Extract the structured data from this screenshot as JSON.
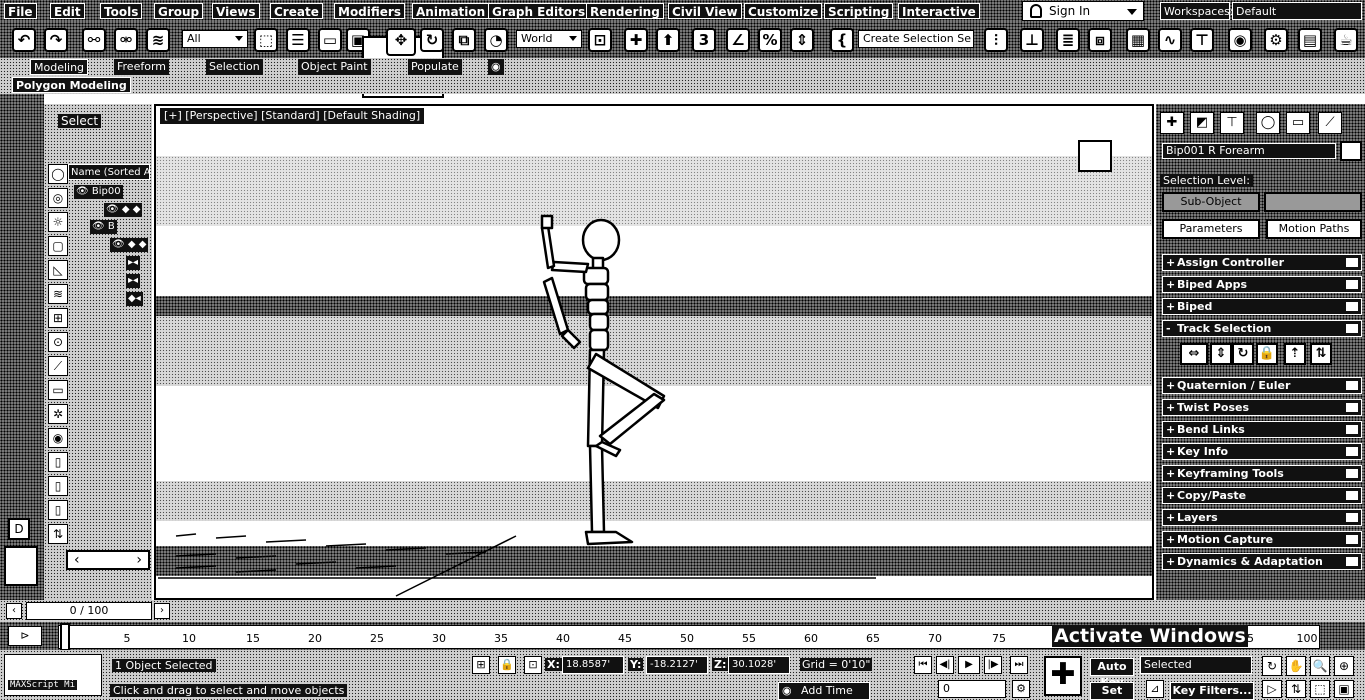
{
  "menu": [
    "File",
    "Edit",
    "Tools",
    "Group",
    "Views",
    "Create",
    "Modifiers",
    "Animation",
    "Graph Editors",
    "Rendering",
    "Civil View",
    "Customize",
    "Scripting",
    "Interactive"
  ],
  "signin_label": "Sign In",
  "workspaces_label": "Workspaces:",
  "workspace_value": "Default",
  "toolbar": {
    "selection_filter": "All",
    "ref_coord": "World",
    "named_selection": "Create Selection Se"
  },
  "ribbon_tabs": [
    "Modeling",
    "Freeform",
    "Selection",
    "Object Paint",
    "Populate"
  ],
  "ribbon_subtitle": "Polygon Modeling",
  "scene_explorer": {
    "select_label": "Select",
    "name_column": "Name (Sorted A",
    "tree_items": [
      "Bip00",
      "◆ ◆",
      "B",
      "◆ ◆"
    ]
  },
  "viewport": {
    "labels": "[+] [Perspective] [Standard] [Default Shading]"
  },
  "command_panel": {
    "object_name": "Bip001 R Forearm",
    "selection_level_label": "Selection Level:",
    "sub_object": "Sub-Object",
    "parameters_button": "Parameters",
    "motion_paths_button": "Motion Paths",
    "rollouts_top": [
      {
        "sign": "+",
        "label": "Assign Controller"
      },
      {
        "sign": "+",
        "label": "Biped Apps"
      },
      {
        "sign": "+",
        "label": "Biped"
      },
      {
        "sign": "-",
        "label": "Track Selection"
      }
    ],
    "rollouts_bottom": [
      {
        "sign": "+",
        "label": "Quaternion / Euler"
      },
      {
        "sign": "+",
        "label": "Twist Poses"
      },
      {
        "sign": "+",
        "label": "Bend Links"
      },
      {
        "sign": "+",
        "label": "Key Info"
      },
      {
        "sign": "+",
        "label": "Keyframing Tools"
      },
      {
        "sign": "+",
        "label": "Copy/Paste"
      },
      {
        "sign": "+",
        "label": "Layers"
      },
      {
        "sign": "+",
        "label": "Motion Capture"
      },
      {
        "sign": "+",
        "label": "Dynamics & Adaptation"
      }
    ]
  },
  "time_slider": {
    "frame_counter": "0 / 100",
    "ticks": [
      "5",
      "10",
      "15",
      "20",
      "25",
      "30",
      "35",
      "40",
      "45",
      "50",
      "55",
      "60",
      "65",
      "70",
      "75",
      "95",
      "100"
    ]
  },
  "watermark": "Activate Windows",
  "status": {
    "maxscript": "MAXScript Mi",
    "selected": "1 Object Selected",
    "prompt": "Click and drag to select and move objects",
    "x_label": "X:",
    "y_label": "Y:",
    "z_label": "Z:",
    "x": "18.8587'",
    "y": "-18.2127'",
    "z": "30.1028'",
    "grid": "Grid = 0'10\"",
    "add_time_tag": "Add Time Tag",
    "current_frame": "0",
    "auto_key": "Auto Key",
    "set_key": "Set Key",
    "selected_drop": "Selected",
    "key_filters": "Key Filters..."
  }
}
